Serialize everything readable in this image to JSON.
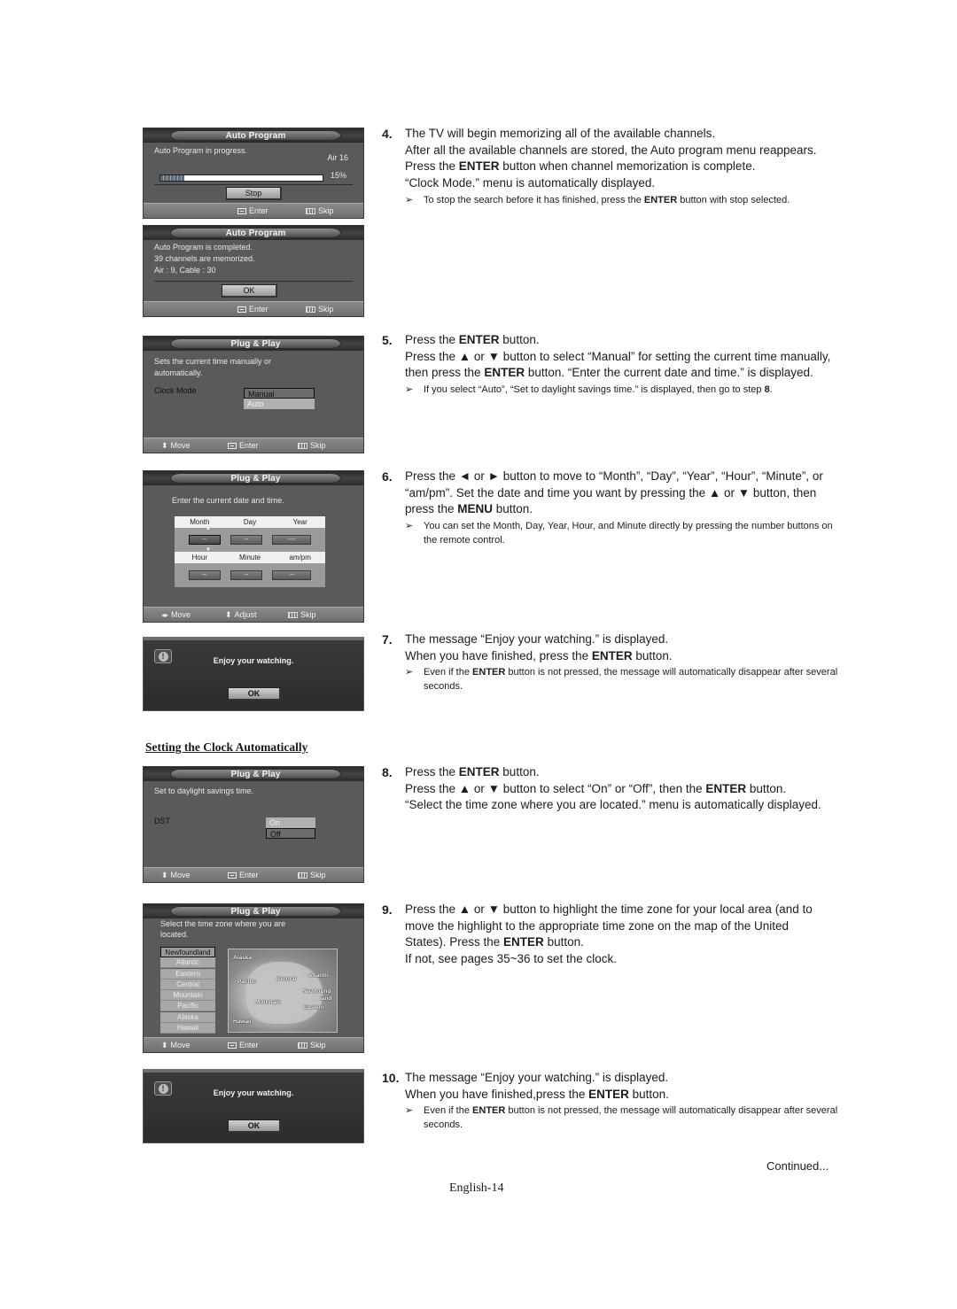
{
  "screens": {
    "auto_program_progress": {
      "title": "Auto Program",
      "status": "Auto Program in progress.",
      "channel": "Air 16",
      "progress_percent": 15,
      "progress_label": "15%",
      "button": "Stop",
      "footer": {
        "enter": "Enter",
        "skip": "Skip"
      }
    },
    "auto_program_done": {
      "title": "Auto Program",
      "lines": [
        "Auto Program is completed.",
        "39 channels are memorized.",
        "Air : 9, Cable : 30"
      ],
      "button": "OK",
      "footer": {
        "enter": "Enter",
        "skip": "Skip"
      }
    },
    "clock_mode": {
      "title": "Plug & Play",
      "desc_1": "Sets the current time manually or",
      "desc_2": "automatically.",
      "label": "Clock Mode",
      "options": [
        "Manual",
        "Auto"
      ],
      "selected": "Manual",
      "footer": {
        "move": "Move",
        "enter": "Enter",
        "skip": "Skip"
      }
    },
    "date_time": {
      "title": "Plug & Play",
      "desc": "Enter the current date and time.",
      "date_headers": [
        "Month",
        "Day",
        "Year"
      ],
      "date_values": [
        "--",
        "--",
        "----"
      ],
      "time_headers": [
        "Hour",
        "Minute",
        "am/pm"
      ],
      "time_values": [
        "--",
        "--",
        "--"
      ],
      "footer": {
        "move": "Move",
        "adjust": "Adjust",
        "skip": "Skip"
      }
    },
    "enjoy_1": {
      "message": "Enjoy your watching.",
      "button": "OK"
    },
    "dst": {
      "title": "Plug & Play",
      "desc": "Set to daylight savings time.",
      "label": "DST",
      "options": [
        "On",
        "Off"
      ],
      "selected": "Off",
      "footer": {
        "move": "Move",
        "enter": "Enter",
        "skip": "Skip"
      }
    },
    "time_zone": {
      "title": "Plug & Play",
      "desc_1": "Select the time zone where you are",
      "desc_2": "located.",
      "zones": [
        "Newfoundland",
        "Atlantic",
        "Eastern",
        "Central",
        "Mountain",
        "Pacific",
        "Alaska",
        "Hawaii"
      ],
      "selected": "Newfoundland",
      "map_labels": {
        "alaska": "Alaska",
        "pacific": "Pacific",
        "central": "Central",
        "atlantic": "Atlantic",
        "newfoundland_1": "Newfound-",
        "newfoundland_2": "land",
        "mountain": "Mountain",
        "eastern": "Eastern",
        "hawaii": "Hawaii"
      },
      "footer": {
        "move": "Move",
        "enter": "Enter",
        "skip": "Skip"
      }
    },
    "enjoy_2": {
      "message": "Enjoy your watching.",
      "button": "OK"
    }
  },
  "section_heading": "Setting the Clock Automatically",
  "steps": [
    {
      "num": "4.",
      "lines": [
        [
          "The TV will begin memorizing all of the available channels."
        ],
        [
          "After all the available channels are stored, the Auto program menu reappears."
        ],
        [
          "Press the ",
          {
            "b": "ENTER"
          },
          " button when channel memorization is complete."
        ],
        [
          "“Clock Mode.” menu is automatically displayed."
        ]
      ],
      "note": [
        "To stop the search before it has finished, press the ",
        {
          "b": "ENTER"
        },
        " button with stop selected."
      ]
    },
    {
      "num": "5.",
      "lines": [
        [
          "Press the ",
          {
            "b": "ENTER"
          },
          " button."
        ],
        [
          "Press the ▲ or ▼ button to select “Manual” for setting the current time manually,"
        ],
        [
          "then press the ",
          {
            "b": "ENTER"
          },
          " button. “Enter the current date and time.” is displayed."
        ]
      ],
      "note": [
        "If you select “Auto”, “Set to daylight savings time.” is displayed, then go to step ",
        {
          "b": "8"
        },
        "."
      ]
    },
    {
      "num": "6.",
      "lines": [
        [
          "Press the ◄ or ► button to move to “Month”, “Day”, “Year”, “Hour”, “Minute”, or"
        ],
        [
          "“am/pm”. Set the date and time you want by pressing the ▲ or ▼ button, then"
        ],
        [
          "press the ",
          {
            "b": "MENU"
          },
          " button."
        ]
      ],
      "note": [
        "You can set the Month, Day, Year, Hour, and Minute directly by pressing the number buttons on the remote control."
      ]
    },
    {
      "num": "7.",
      "lines": [
        [
          "The message “Enjoy your watching.” is displayed."
        ],
        [
          "When you have finished, press the ",
          {
            "b": "ENTER"
          },
          " button."
        ]
      ],
      "note": [
        "Even if the ",
        {
          "b": "ENTER"
        },
        " button is not pressed, the message will automatically disappear after several seconds."
      ]
    },
    {
      "num": "8.",
      "lines": [
        [
          "Press the ",
          {
            "b": "ENTER"
          },
          " button."
        ],
        [
          "Press the ▲ or ▼ button to select “On” or “Off”, then the ",
          {
            "b": "ENTER"
          },
          " button."
        ],
        [
          "“Select the time zone where you are located.” menu is automatically displayed."
        ]
      ],
      "note": null
    },
    {
      "num": "9.",
      "lines": [
        [
          "Press the ▲ or ▼ button to highlight the time zone for your local area (and to"
        ],
        [
          "move the highlight to the appropriate time zone on the map of the United"
        ],
        [
          "States). Press the ",
          {
            "b": "ENTER"
          },
          " button."
        ],
        [
          "If not, see pages 35~36 to set the clock."
        ]
      ],
      "note": null
    },
    {
      "num": "10.",
      "lines": [
        [
          "The message “Enjoy your watching.” is displayed."
        ],
        [
          "When you have finished,press the ",
          {
            "b": "ENTER"
          },
          " button."
        ]
      ],
      "note": [
        "Even if the ",
        {
          "b": "ENTER"
        },
        " button is not pressed, the message will automatically disappear after several seconds."
      ]
    }
  ],
  "note_arrow": "➢",
  "continued": "Continued...",
  "page_number": "English-14"
}
